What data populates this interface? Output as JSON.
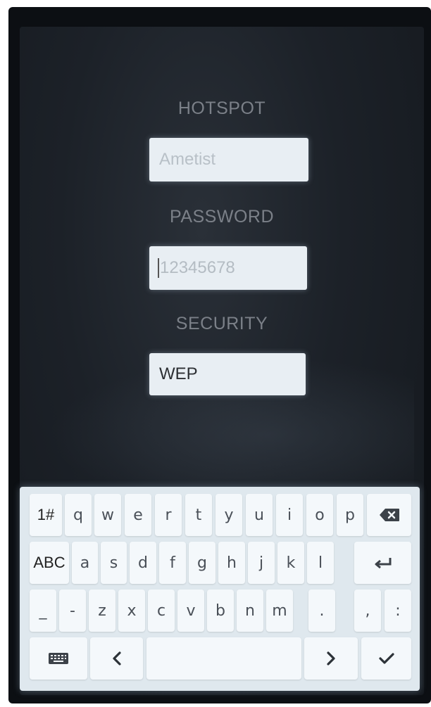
{
  "form": {
    "hotspot": {
      "label": "HOTSPOT",
      "placeholder": "Ametist"
    },
    "password": {
      "label": "PASSWORD",
      "placeholder": "12345678"
    },
    "security": {
      "label": "SECURITY",
      "value": "WEP"
    }
  },
  "keyboard": {
    "row1": [
      "1#",
      "q",
      "w",
      "e",
      "r",
      "t",
      "y",
      "u",
      "i",
      "o",
      "p"
    ],
    "row2": [
      "ABC",
      "a",
      "s",
      "d",
      "f",
      "g",
      "h",
      "j",
      "k",
      "l"
    ],
    "row3": [
      "_",
      "-",
      "z",
      "x",
      "c",
      "v",
      "b",
      "n",
      "m",
      ".",
      ",",
      ":"
    ],
    "icons": {
      "backspace": "backspace-icon",
      "enter": "enter-icon",
      "keyboard": "keyboard-icon",
      "left": "chevron-left-icon",
      "right": "chevron-right-icon",
      "done": "checkmark-icon"
    }
  }
}
